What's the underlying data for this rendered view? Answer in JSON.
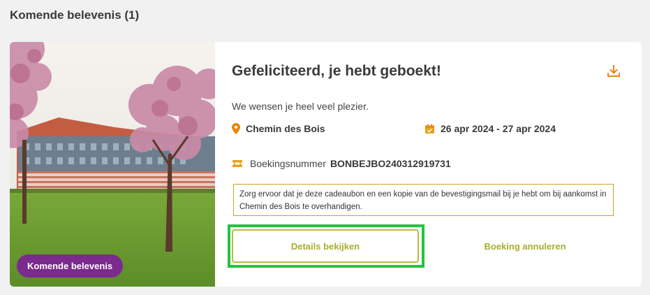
{
  "section": {
    "title": "Komende belevenis (1)"
  },
  "card": {
    "badge": "Komende belevenis",
    "headline": "Gefeliciteerd, je hebt geboekt!",
    "subtitle": "We wensen je heel veel plezier.",
    "location": "Chemin des Bois",
    "dates": "26 apr 2024 - 27 apr 2024",
    "booking_label": "Boekingsnummer",
    "booking_number": "BONBEJBO240312919731",
    "notice": "Zorg ervoor dat je deze cadeaubon en een kopie van de bevestigingsmail bij je hebt om bij aankomst in Chemin des Bois te overhandigen.",
    "details_button": "Details bekijken",
    "cancel_button": "Boeking annuleren"
  },
  "icons": {
    "download": "download-icon",
    "location": "location-pin-icon",
    "calendar": "calendar-icon",
    "ticket": "ticket-icon"
  },
  "colors": {
    "accent_orange": "#e8850c",
    "button_green": "#a7ae2f",
    "badge_purple": "#7b2a8e",
    "highlight_green": "#22c440",
    "notice_border": "#c9a227"
  }
}
